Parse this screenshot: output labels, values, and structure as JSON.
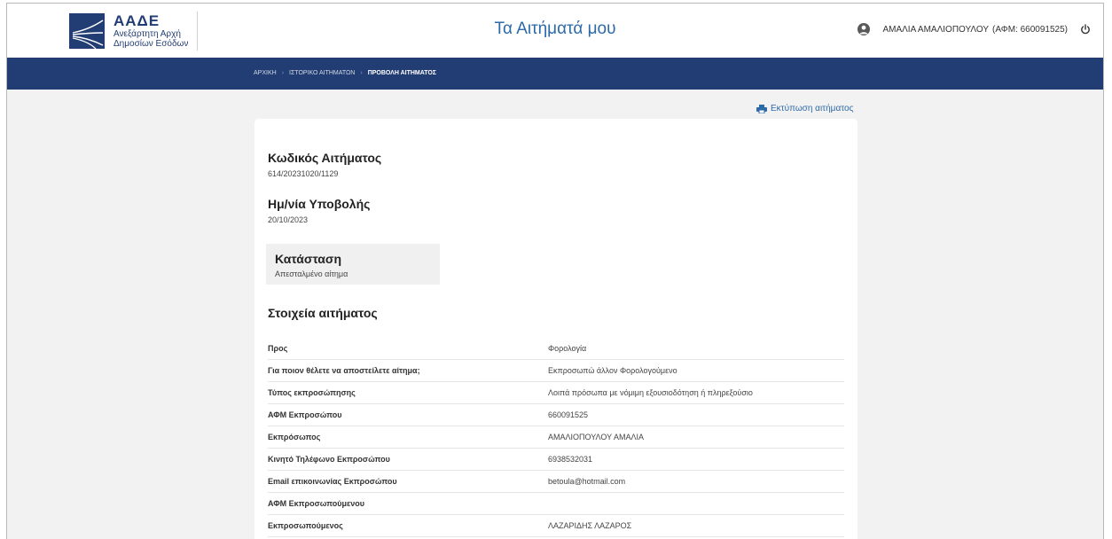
{
  "header": {
    "logo_abbr": "ΑΑΔΕ",
    "logo_line1": "Ανεξάρτητη Αρχή",
    "logo_line2": "Δημοσίων Εσόδων",
    "title": "Τα Αιτήματά μου",
    "user_name": "ΑΜΑΛΙΑ ΑΜΑΛΙΟΠΟΥΛΟΥ",
    "user_afm": "(ΑΦΜ: 660091525)"
  },
  "breadcrumb": {
    "items": [
      "ΑΡΧΙΚΗ",
      "ΙΣΤΟΡΙΚΟ ΑΙΤΗΜΑΤΩΝ",
      "ΠΡΟΒΟΛΗ ΑΙΤΗΜΑΤΟΣ"
    ]
  },
  "actions": {
    "print_label": "Εκτύπωση αιτήματος"
  },
  "request": {
    "code_label": "Κωδικός Αιτήματος",
    "code_value": "614/20231020/1129",
    "date_label": "Ημ/νία Υποβολής",
    "date_value": "20/10/2023",
    "status_label": "Κατάσταση",
    "status_value": "Απεσταλμένο αίτημα"
  },
  "details": {
    "title": "Στοιχεία αιτήματος",
    "rows": [
      {
        "label": "Προς",
        "value": "Φορολογία"
      },
      {
        "label": "Για ποιον θέλετε να αποστείλετε αίτημα;",
        "value": "Εκπροσωπώ άλλον Φορολογούμενο"
      },
      {
        "label": "Τύπος εκπροσώπησης",
        "value": "Λοιπά πρόσωπα με νόμιμη εξουσιοδότηση ή πληρεξούσιο"
      },
      {
        "label": "ΑΦΜ Εκπροσώπου",
        "value": "660091525"
      },
      {
        "label": "Εκπρόσωπος",
        "value": "ΑΜΑΛΙΟΠΟΥΛΟΥ ΑΜΑΛΙΑ"
      },
      {
        "label": "Κινητό Τηλέφωνο Εκπροσώπου",
        "value": "6938532031"
      },
      {
        "label": "Email επικοινωνίας Εκπροσώπου",
        "value": "betoula@hotmail.com"
      },
      {
        "label": "ΑΦΜ Εκπροσωπούμενου",
        "value": ""
      },
      {
        "label": "Εκπροσωπούμενος",
        "value": "ΛΑΖΑΡΙΔΗΣ ΛΑΖΑΡΟΣ"
      }
    ]
  },
  "colors": {
    "brand": "#223d73",
    "link": "#2d6aa8",
    "page_bg": "#f2f2f2"
  }
}
